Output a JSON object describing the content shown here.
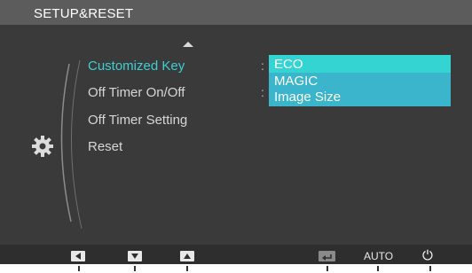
{
  "header": {
    "title": "SETUP&RESET"
  },
  "menu": {
    "items": [
      {
        "label": "Customized Key",
        "active": true
      },
      {
        "label": "Off Timer On/Off",
        "active": false
      },
      {
        "label": "Off Timer Setting",
        "active": false
      },
      {
        "label": "Reset",
        "active": false
      }
    ],
    "separator": ":"
  },
  "submenu": {
    "options": [
      "ECO",
      "MAGIC",
      "Image Size"
    ],
    "selected": "ECO"
  },
  "footer": {
    "buttons": [
      {
        "icon": "left-arrow-icon"
      },
      {
        "icon": "down-arrow-icon"
      },
      {
        "icon": "up-arrow-icon"
      },
      {
        "icon": "enter-icon"
      }
    ],
    "auto_label": "AUTO",
    "power_glyph": "⏻"
  },
  "icons": {
    "category": "gear-icon",
    "scroll_up": "up-triangle-icon"
  },
  "colors": {
    "background": "#3a3a3a",
    "titlebar": "#5c5c5c",
    "active_text": "#3ccfd3",
    "submenu_bg": "#3ab5cc",
    "submenu_highlight": "#33d4d2"
  }
}
